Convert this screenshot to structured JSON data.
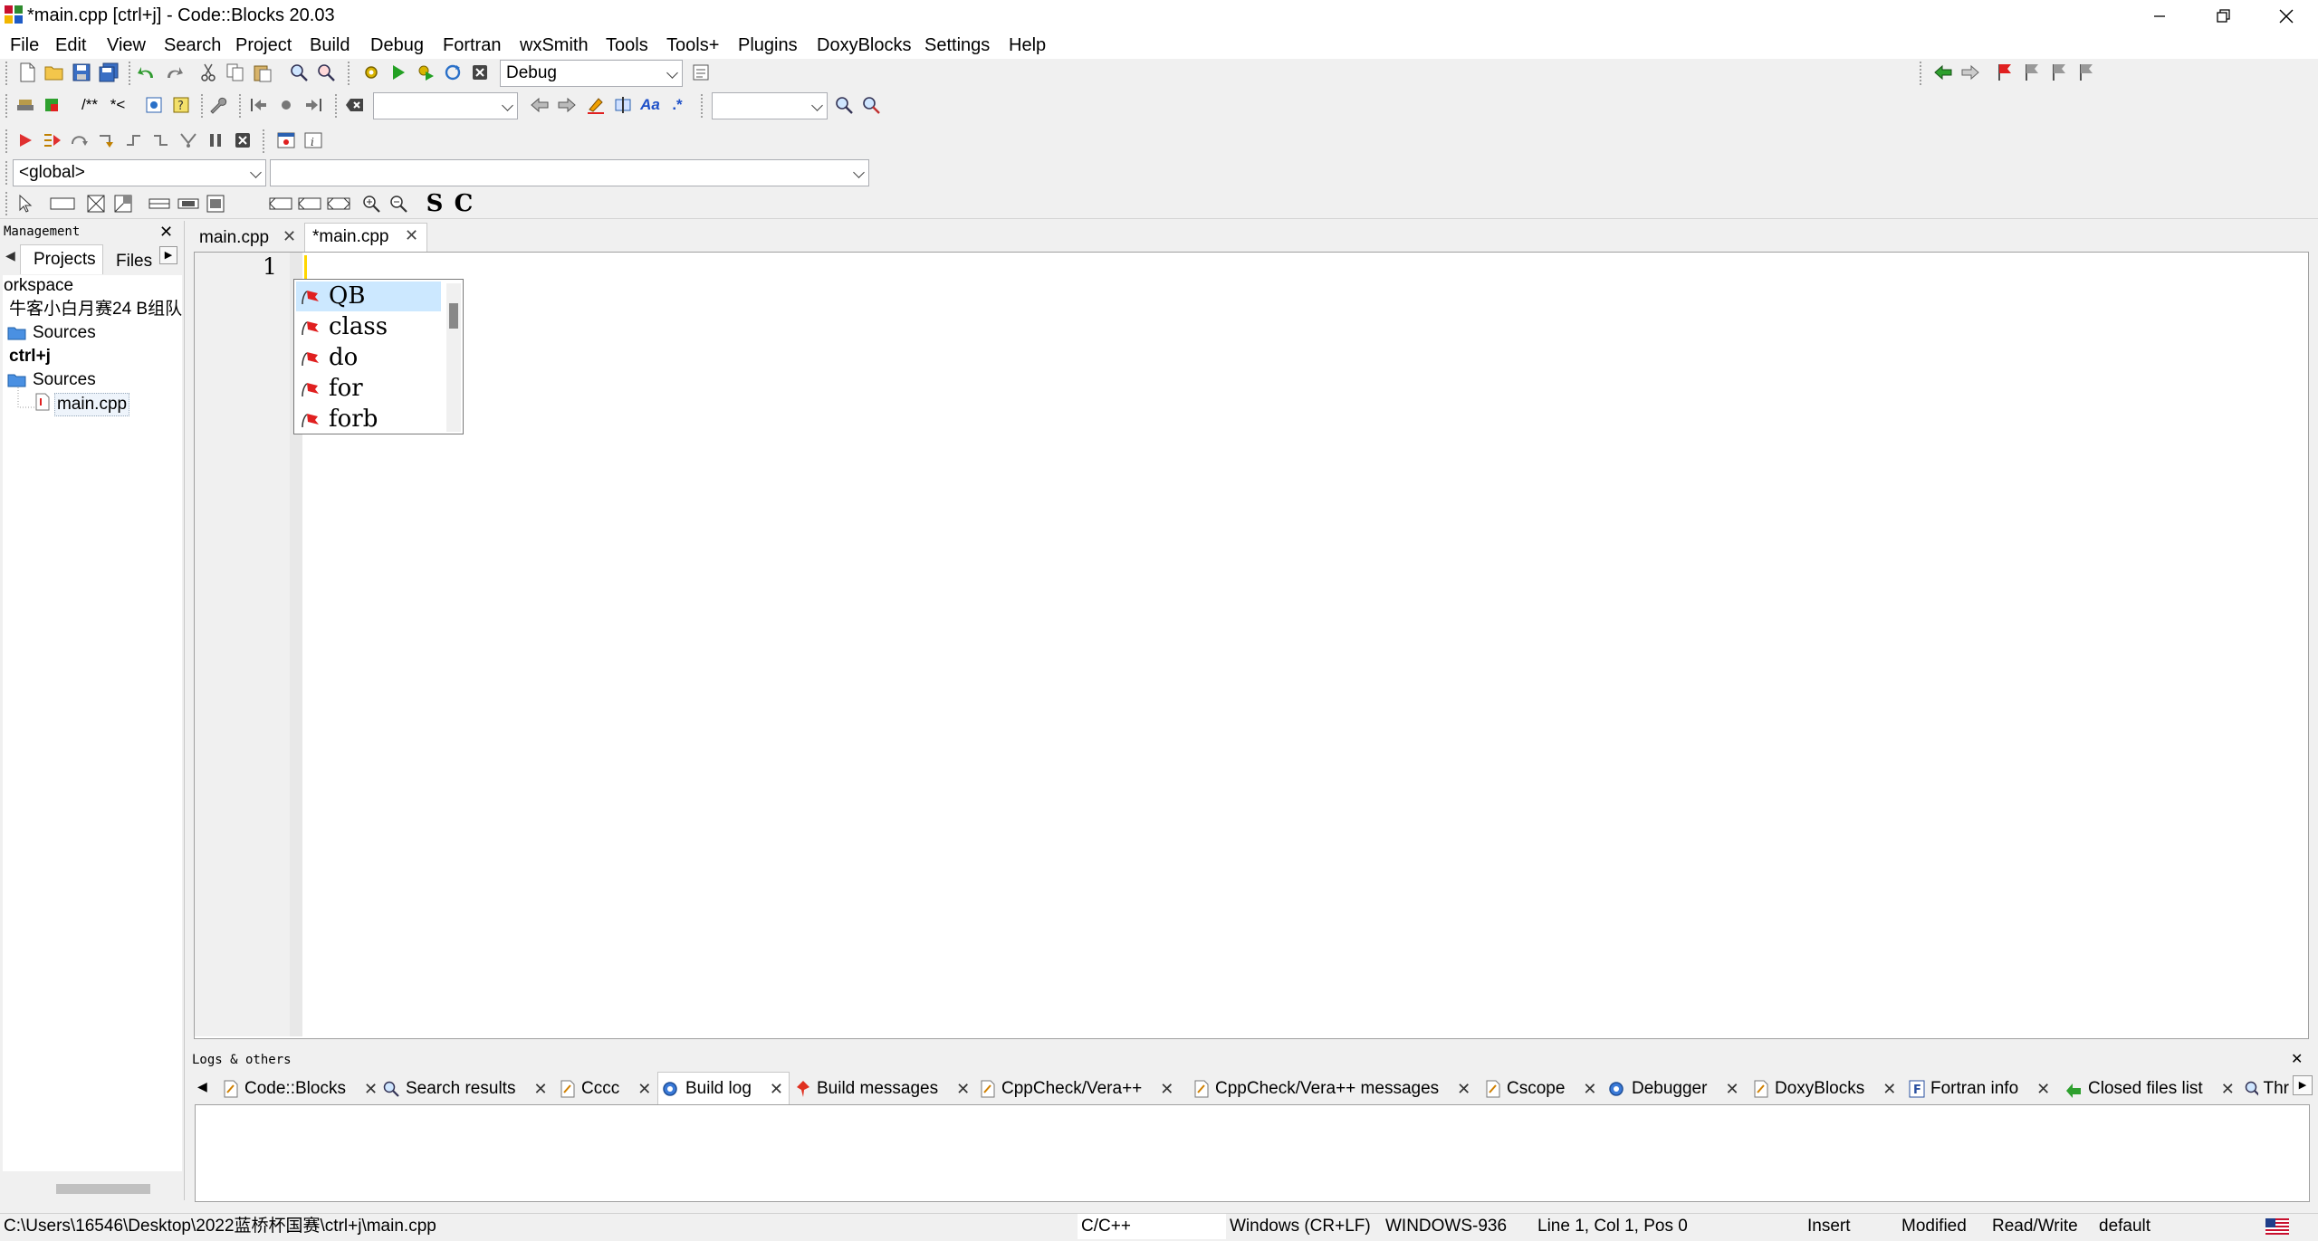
{
  "window": {
    "title": "*main.cpp [ctrl+j] - Code::Blocks 20.03"
  },
  "menu": [
    "File",
    "Edit",
    "View",
    "Search",
    "Project",
    "Build",
    "Debug",
    "Fortran",
    "wxSmith",
    "Tools",
    "Tools+",
    "Plugins",
    "DoxyBlocks",
    "Settings",
    "Help"
  ],
  "toolbar": {
    "build_target": "Debug",
    "scope_combo": "<global>",
    "function_combo": "",
    "search_combo": "",
    "replace_combo": "",
    "doc_style": "/**",
    "doc_inline": "*<",
    "text_s": "S",
    "text_c": "C"
  },
  "management": {
    "title": "Management",
    "tabs": [
      "Projects",
      "Files"
    ],
    "tree": [
      {
        "label": "orkspace",
        "bold": false
      },
      {
        "label": "牛客小白月赛24 B组队",
        "bold": false
      },
      {
        "label": "Sources",
        "bold": false
      },
      {
        "label": "ctrl+j",
        "bold": true
      },
      {
        "label": "Sources",
        "bold": false
      },
      {
        "label": "main.cpp",
        "bold": false
      }
    ]
  },
  "editor": {
    "tabs": [
      {
        "label": "main.cpp",
        "active": false
      },
      {
        "label": "*main.cpp",
        "active": true
      }
    ],
    "line_number": "1",
    "autocomplete": [
      "QB",
      "class",
      "do",
      "for",
      "forb"
    ]
  },
  "logs": {
    "title": "Logs & others",
    "tabs": [
      "Code::Blocks",
      "Search results",
      "Cccc",
      "Build log",
      "Build messages",
      "CppCheck/Vera++",
      "CppCheck/Vera++ messages",
      "Cscope",
      "Debugger",
      "DoxyBlocks",
      "Fortran info",
      "Closed files list",
      "Thr"
    ]
  },
  "status": {
    "path": "C:\\Users\\16546\\Desktop\\2022蓝桥杯国赛\\ctrl+j\\main.cpp",
    "language": "C/C++",
    "line_endings": "Windows (CR+LF)",
    "encoding": "WINDOWS-936",
    "position": "Line 1, Col 1, Pos 0",
    "mode": "Insert",
    "modified": "Modified",
    "access": "Read/Write",
    "profile": "default"
  },
  "colors": {
    "accent_selection": "#cce8ff",
    "caret": "#ffd700",
    "flag": "#e02020"
  }
}
